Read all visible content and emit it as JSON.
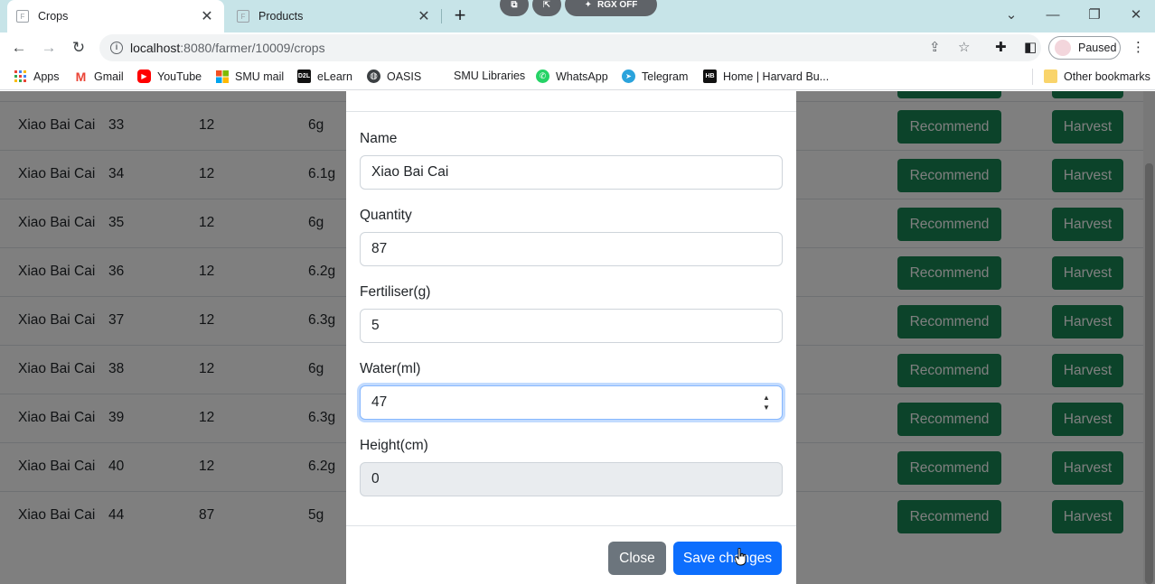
{
  "browser": {
    "tabs": [
      {
        "title": "Crops",
        "favicon": "F",
        "active": true
      },
      {
        "title": "Products",
        "favicon": "F",
        "active": false
      }
    ],
    "extension_pill_label": "RGX OFF",
    "url_host": "localhost",
    "url_path": ":8080/farmer/10009/crops",
    "profile_label": "Paused",
    "bookmarks": [
      {
        "label": "Apps",
        "icon": "apps-grid-icon"
      },
      {
        "label": "Gmail",
        "icon": "gmail-icon"
      },
      {
        "label": "YouTube",
        "icon": "youtube-icon"
      },
      {
        "label": "SMU mail",
        "icon": "microsoft-icon"
      },
      {
        "label": "eLearn",
        "icon": "d2l-icon"
      },
      {
        "label": "OASIS",
        "icon": "globe-icon"
      },
      {
        "label": "SMU Libraries",
        "icon": "blank-icon"
      },
      {
        "label": "WhatsApp",
        "icon": "whatsapp-icon"
      },
      {
        "label": "Telegram",
        "icon": "telegram-icon"
      },
      {
        "label": "Home | Harvard Bu...",
        "icon": "hbr-icon"
      },
      {
        "label": "Other bookmarks",
        "icon": "folder-icon"
      }
    ],
    "bookmark_icon_text": {
      "d2l": "D2L",
      "hbr": "HB"
    }
  },
  "table": {
    "recommend_label": "Recommend",
    "harvest_label": "Harvest",
    "rows": [
      {
        "name": "Xiao Bai Cai",
        "id": "33",
        "qty": "12",
        "fert": "6g"
      },
      {
        "name": "Xiao Bai Cai",
        "id": "34",
        "qty": "12",
        "fert": "6.1g"
      },
      {
        "name": "Xiao Bai Cai",
        "id": "35",
        "qty": "12",
        "fert": "6g"
      },
      {
        "name": "Xiao Bai Cai",
        "id": "36",
        "qty": "12",
        "fert": "6.2g"
      },
      {
        "name": "Xiao Bai Cai",
        "id": "37",
        "qty": "12",
        "fert": "6.3g"
      },
      {
        "name": "Xiao Bai Cai",
        "id": "38",
        "qty": "12",
        "fert": "6g"
      },
      {
        "name": "Xiao Bai Cai",
        "id": "39",
        "qty": "12",
        "fert": "6.3g"
      },
      {
        "name": "Xiao Bai Cai",
        "id": "40",
        "qty": "12",
        "fert": "6.2g"
      },
      {
        "name": "Xiao Bai Cai",
        "id": "44",
        "qty": "87",
        "fert": "5g"
      }
    ]
  },
  "modal": {
    "fields": {
      "name": {
        "label": "Name",
        "value": "Xiao Bai Cai"
      },
      "quantity": {
        "label": "Quantity",
        "value": "87"
      },
      "fertiliser": {
        "label": "Fertiliser(g)",
        "value": "5"
      },
      "water": {
        "label": "Water(ml)",
        "value": "47"
      },
      "height": {
        "label": "Height(cm)",
        "value": "0"
      }
    },
    "close_label": "Close",
    "save_label": "Save changes"
  },
  "colors": {
    "success": "#198754",
    "primary": "#0d6efd",
    "secondary": "#6c757d",
    "tabstrip": "#c7e4e8"
  }
}
